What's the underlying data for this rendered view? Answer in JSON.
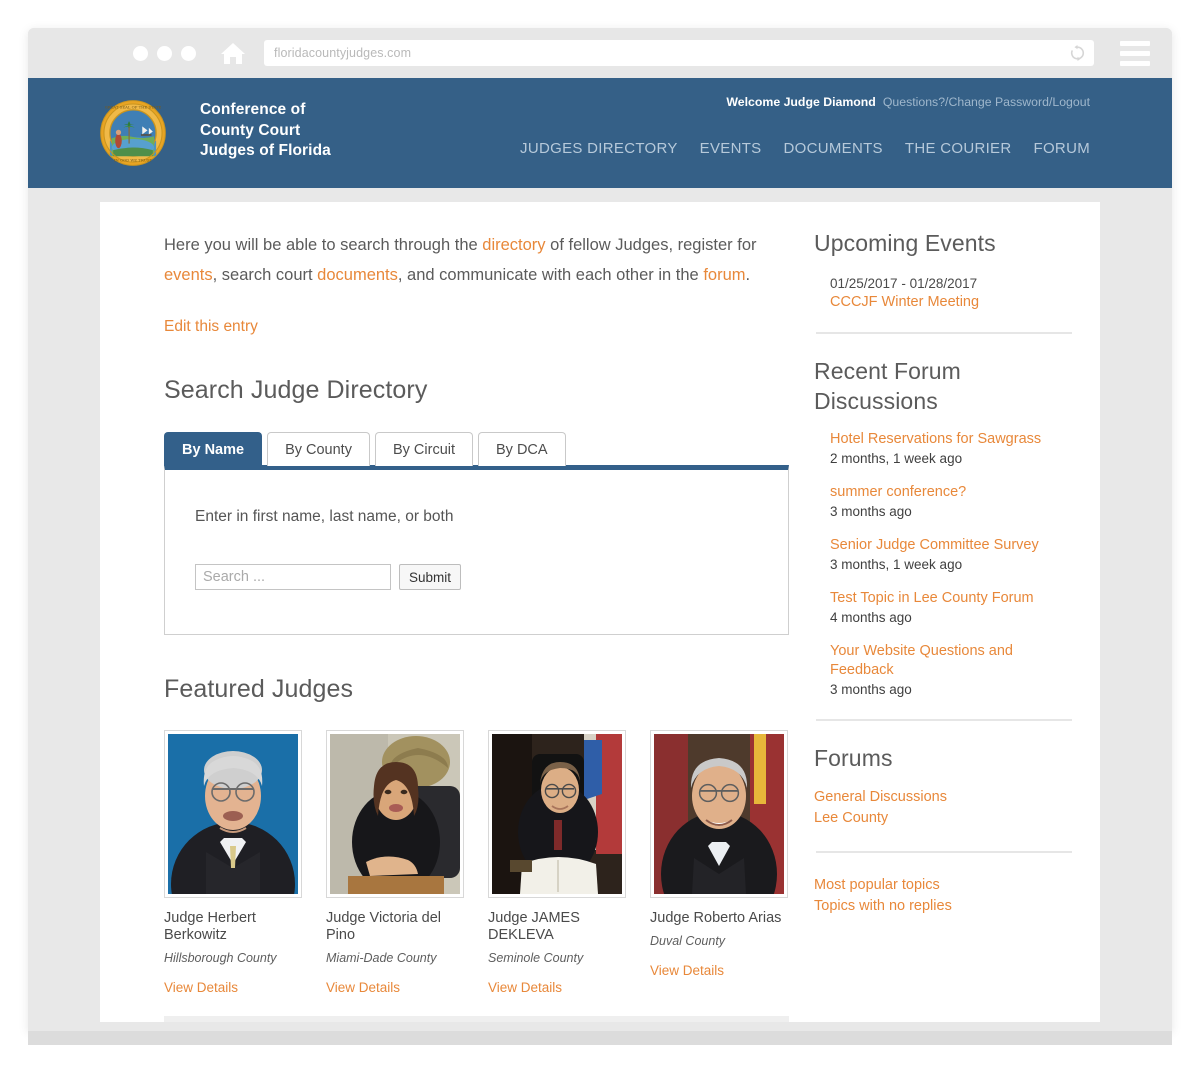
{
  "browser": {
    "url": "floridacountyjudges.com",
    "home_icon": "home-icon",
    "reload_icon": "reload-icon",
    "menu_icon": "hamburger-menu-icon"
  },
  "header": {
    "logo_alt": "Great Seal of the State of Florida",
    "brand_line1": "Conference of",
    "brand_line2": "County Court",
    "brand_line3": "Judges of Florida",
    "welcome": "Welcome Judge Diamond",
    "user_links": [
      {
        "label": "Questions?"
      },
      {
        "label": "Change Password"
      },
      {
        "label": "Logout"
      }
    ],
    "separator": "/",
    "nav": [
      {
        "label": "JUDGES DIRECTORY"
      },
      {
        "label": "EVENTS"
      },
      {
        "label": "DOCUMENTS"
      },
      {
        "label": "THE COURIER"
      },
      {
        "label": "FORUM"
      }
    ]
  },
  "main": {
    "intro": {
      "part1": "Here you will be able to search through the ",
      "link1": "directory",
      "part2": " of fellow Judges, register for ",
      "link2": "events",
      "part3": ", search court ",
      "link3": "documents",
      "part4": ", and communicate with each other in the ",
      "link4": "forum",
      "part5": "."
    },
    "edit_entry": "Edit this entry",
    "search_section_title": "Search Judge Directory",
    "tabs": [
      {
        "label": "By Name",
        "active": true
      },
      {
        "label": "By County",
        "active": false
      },
      {
        "label": "By Circuit",
        "active": false
      },
      {
        "label": "By DCA",
        "active": false
      }
    ],
    "search_hint": "Enter in first name, last name, or both",
    "search_placeholder": "Search ...",
    "search_value": "",
    "submit_label": "Submit",
    "featured_title": "Featured Judges",
    "judges": [
      {
        "name": "Judge Herbert Berkowitz",
        "county": "Hillsborough County",
        "link": "View Details",
        "photo_desc": "older man with glasses in black robe on blue background"
      },
      {
        "name": "Judge Victoria del Pino",
        "county": "Miami-Dade County",
        "link": "View Details",
        "photo_desc": "woman in black robe seated at bench"
      },
      {
        "name": "Judge JAMES DEKLEVA",
        "county": "Seminole County",
        "link": "View Details",
        "photo_desc": "judge with glasses writing at bench with flag"
      },
      {
        "name": "Judge Roberto Arias",
        "county": "Duval County",
        "link": "View Details",
        "photo_desc": "smiling man with glasses in black robe by flags"
      }
    ]
  },
  "sidebar": {
    "events_title": "Upcoming Events",
    "events": [
      {
        "date": "01/25/2017 - 01/28/2017",
        "name": "CCCJF Winter Meeting"
      }
    ],
    "forum_title": "Recent Forum Discussions",
    "topics": [
      {
        "title": "Hotel Reservations for Sawgrass",
        "age": "2 months, 1 week ago"
      },
      {
        "title": "summer conference?",
        "age": "3 months ago"
      },
      {
        "title": "Senior Judge Committee Survey",
        "age": "3 months, 1 week ago"
      },
      {
        "title": "Test Topic in Lee County Forum",
        "age": "4 months ago"
      },
      {
        "title": "Your Website Questions and Feedback",
        "age": "3 months ago"
      }
    ],
    "forums_title": "Forums",
    "forums": [
      {
        "label": "General Discussions"
      },
      {
        "label": "Lee County"
      }
    ],
    "extras": [
      {
        "label": "Most popular topics"
      },
      {
        "label": "Topics with no replies"
      }
    ]
  },
  "colors": {
    "header_blue": "#356087",
    "accent_orange": "#e8883a",
    "page_bg": "#e8e8e8",
    "text_gray": "#5b5b5b"
  }
}
